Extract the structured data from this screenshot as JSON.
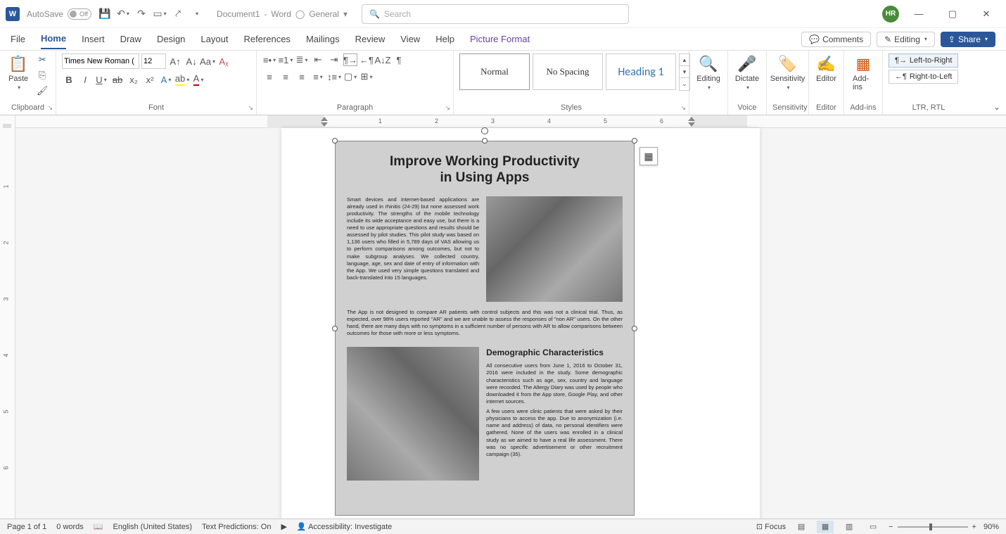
{
  "titlebar": {
    "autosave": "AutoSave",
    "autosave_state": "Off",
    "document_name": "Document1",
    "app_name": "Word",
    "privacy_label": "General",
    "search_placeholder": "Search",
    "user_initials": "HR"
  },
  "tabs": {
    "items": [
      "File",
      "Home",
      "Insert",
      "Draw",
      "Design",
      "Layout",
      "References",
      "Mailings",
      "Review",
      "View",
      "Help"
    ],
    "context_tab": "Picture Format",
    "active_index": 1,
    "comments": "Comments",
    "editing": "Editing",
    "share": "Share"
  },
  "ribbon": {
    "clipboard": {
      "label": "Clipboard",
      "paste": "Paste"
    },
    "font": {
      "label": "Font",
      "name": "Times New Roman (",
      "size": "12"
    },
    "paragraph": {
      "label": "Paragraph"
    },
    "styles": {
      "label": "Styles",
      "items": [
        "Normal",
        "No Spacing",
        "Heading 1"
      ]
    },
    "editing": {
      "label": "Editing",
      "button": "Editing"
    },
    "voice": {
      "label": "Voice",
      "dictate": "Dictate"
    },
    "sensitivity": {
      "label": "Sensitivity",
      "button": "Sensitivity"
    },
    "editor": {
      "label": "Editor",
      "button": "Editor"
    },
    "addins": {
      "label": "Add-ins",
      "button": "Add-ins"
    },
    "ltr_rtl": {
      "label": "LTR, RTL",
      "ltr": "Left-to-Right",
      "rtl": "Right-to-Left"
    }
  },
  "ruler": {
    "h_numbers": [
      "1",
      "2",
      "3",
      "4",
      "5",
      "6"
    ],
    "v_numbers": [
      "1",
      "2",
      "3",
      "4",
      "5",
      "6"
    ]
  },
  "document_image": {
    "title_line1": "Improve Working Productivity",
    "title_line2": "in Using Apps",
    "para1": "Smart devices and internet-based applications are already used in rhinitis (24-29) but none assessed work productivity. The strengths of the mobile technology include its wide acceptance and easy use, but there is a need to use appropriate questions and results should be assessed by pilot studies. This pilot study was based on 1,136 users who filled in 5,789 days of VAS allowing us to perform comparisons among outcomes, but not to make subgroup analyses. We collected country, language, age, sex and date of entry of information with the App. We used very simple questions translated and back-translated into 15 languages.",
    "para2": "The App is not designed to compare AR patients with control subjects and this was not a clinical trial. Thus, as expected, over 98% users reported \"AR\" and we are unable to assess the responses of \"non AR\" users. On the other hand, there are many days with no symptoms in a sufficient number of persons with AR to allow comparisons between outcomes for those with more or less symptoms.",
    "sub_heading": "Demographic Characteristics",
    "para3a": "All consecutive users from June 1, 2016 to October 31, 2016 were included in the study. Some demographic characteristics such as age, sex, country and language were recorded. The Allergy Diary was used by people who downloaded it from the App store, Google Play, and other internet sources.",
    "para3b": "A few users were clinic patients that were asked by their physicians to access the app. Due to anonymization (i.e. name and address) of data, no personal identifiers were gathered. None of the users was enrolled in a clinical study as we aimed to have a real life assessment. There was no specific advertisement or other recruitment campaign (35)."
  },
  "statusbar": {
    "page": "Page 1 of 1",
    "words": "0 words",
    "language": "English (United States)",
    "predictions": "Text Predictions: On",
    "accessibility": "Accessibility: Investigate",
    "focus": "Focus",
    "zoom": "90%"
  }
}
